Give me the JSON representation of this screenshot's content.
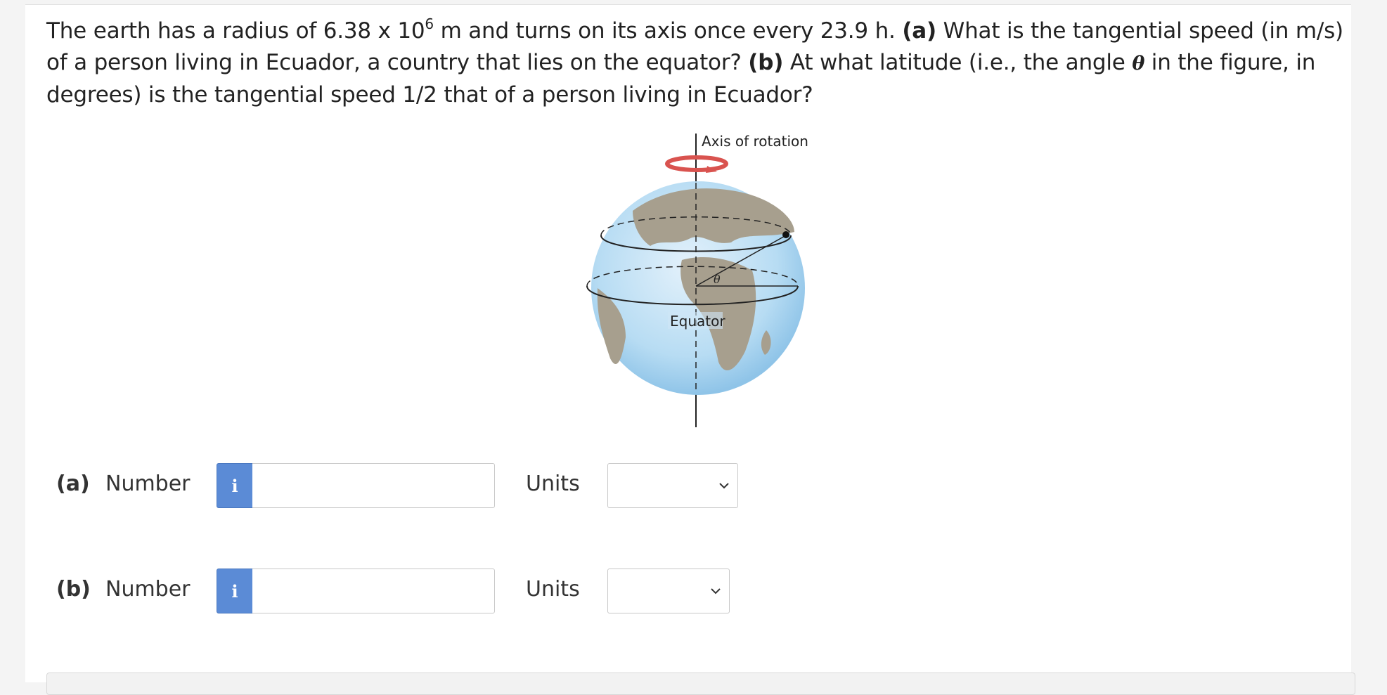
{
  "question": {
    "p1": "The earth has a radius of 6.38 x 10",
    "exp": "6",
    "p2": " m and turns on its axis once every 23.9 h. ",
    "a_tag": "(a)",
    "p3": " What is the tangential speed (in m/s) of a person living in Ecuador, a country that lies on the equator? ",
    "b_tag": "(b)",
    "p4": " At what latitude (i.e., the angle ",
    "theta": "θ",
    "p5": " in the figure, in degrees) is the tangential speed 1/2 that of a person living in Ecuador?"
  },
  "figure": {
    "axis_label": "Axis of rotation",
    "equator_label": "Equator",
    "theta_label": "θ"
  },
  "rows": [
    {
      "part": "(a)",
      "number_label": "Number",
      "info_icon": "i",
      "value": "",
      "units_label": "Units",
      "units_selected": ""
    },
    {
      "part": "(b)",
      "number_label": "Number",
      "info_icon": "i",
      "value": "",
      "units_label": "Units",
      "units_selected": ""
    }
  ],
  "colors": {
    "info_blue": "#5b8bd6",
    "arrow_red": "#d9534f"
  }
}
